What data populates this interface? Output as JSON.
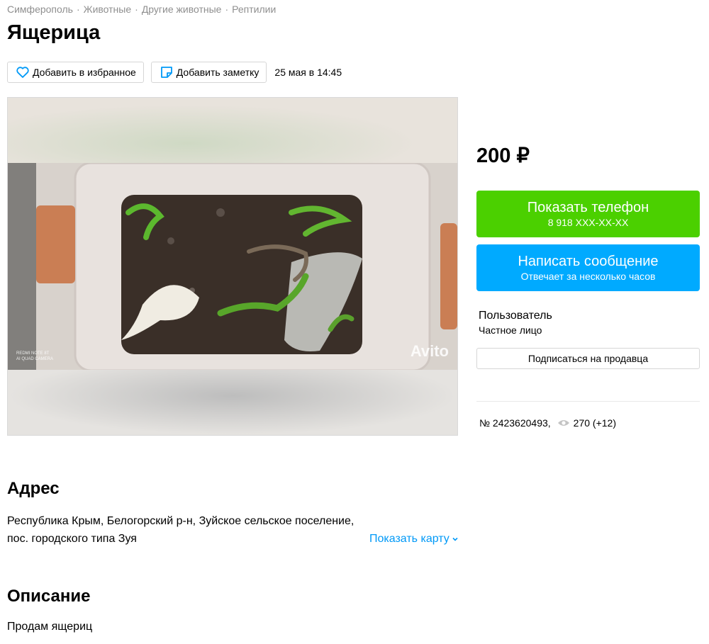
{
  "breadcrumbs": [
    "Симферополь",
    "Животные",
    "Другие животные",
    "Рептилии"
  ],
  "title": "Ящерица",
  "actions": {
    "favorite_label": "Добавить в избранное",
    "note_label": "Добавить заметку",
    "date": "25 мая в 14:45"
  },
  "photo": {
    "watermark": "Avito",
    "camera_line1": "REDMI NOTE 8T",
    "camera_line2": "AI QUAD CAMERA"
  },
  "price": "200 ₽",
  "phone_button": {
    "label": "Показать телефон",
    "number": "8 918 XXX-XX-XX"
  },
  "message_button": {
    "label": "Написать сообщение",
    "sub": "Отвечает за несколько часов"
  },
  "seller": {
    "name": "Пользователь",
    "type": "Частное лицо",
    "subscribe_label": "Подписаться на продавца"
  },
  "meta": {
    "item_no": "№ 2423620493,",
    "views": "270 (+12)"
  },
  "address": {
    "heading": "Адрес",
    "line1": "Республика Крым, Белогорский р-н, Зуйское сельское поселение,",
    "line2": "пос. городского типа Зуя",
    "map_link": "Показать карту"
  },
  "description": {
    "heading": "Описание",
    "text": "Продам ящериц"
  },
  "colors": {
    "green": "#4bd000",
    "blue": "#00aaff",
    "link": "#0099f7",
    "breadcrumb": "#8f8f8f"
  },
  "icons": [
    "heart-icon",
    "note-icon",
    "eye-icon",
    "chevron-down-icon"
  ]
}
